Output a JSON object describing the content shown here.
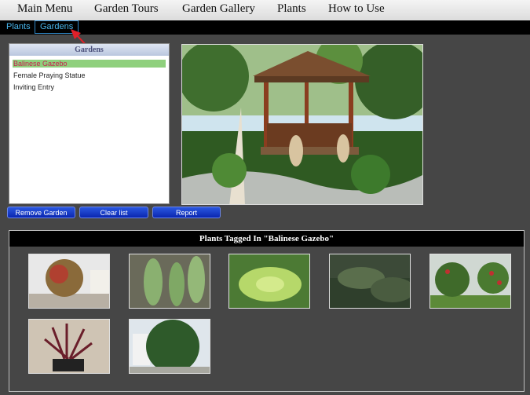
{
  "menu": {
    "items": [
      "Main Menu",
      "Garden Tours",
      "Garden Gallery",
      "Plants",
      "How to Use"
    ]
  },
  "tabs": [
    {
      "label": "Plants",
      "active": false
    },
    {
      "label": "Gardens",
      "active": true
    }
  ],
  "gardens": {
    "header": "Gardens",
    "items": [
      {
        "label": "Balinese Gazebo",
        "selected": true
      },
      {
        "label": "Female Praying Statue",
        "selected": false
      },
      {
        "label": "Inviting Entry",
        "selected": false
      }
    ]
  },
  "buttons": {
    "remove": "Remove Garden",
    "clear": "Clear list",
    "report": "Report"
  },
  "tagged": {
    "header": "Plants Tagged In \"Balinese Gazebo\""
  },
  "colors": {
    "background": "#464646",
    "tab_text": "#48b4ea",
    "selected_row": "#8fd07d",
    "selected_text": "#c8204e",
    "button": "#1a3fd0",
    "annotation_arrow": "#e0202a"
  }
}
